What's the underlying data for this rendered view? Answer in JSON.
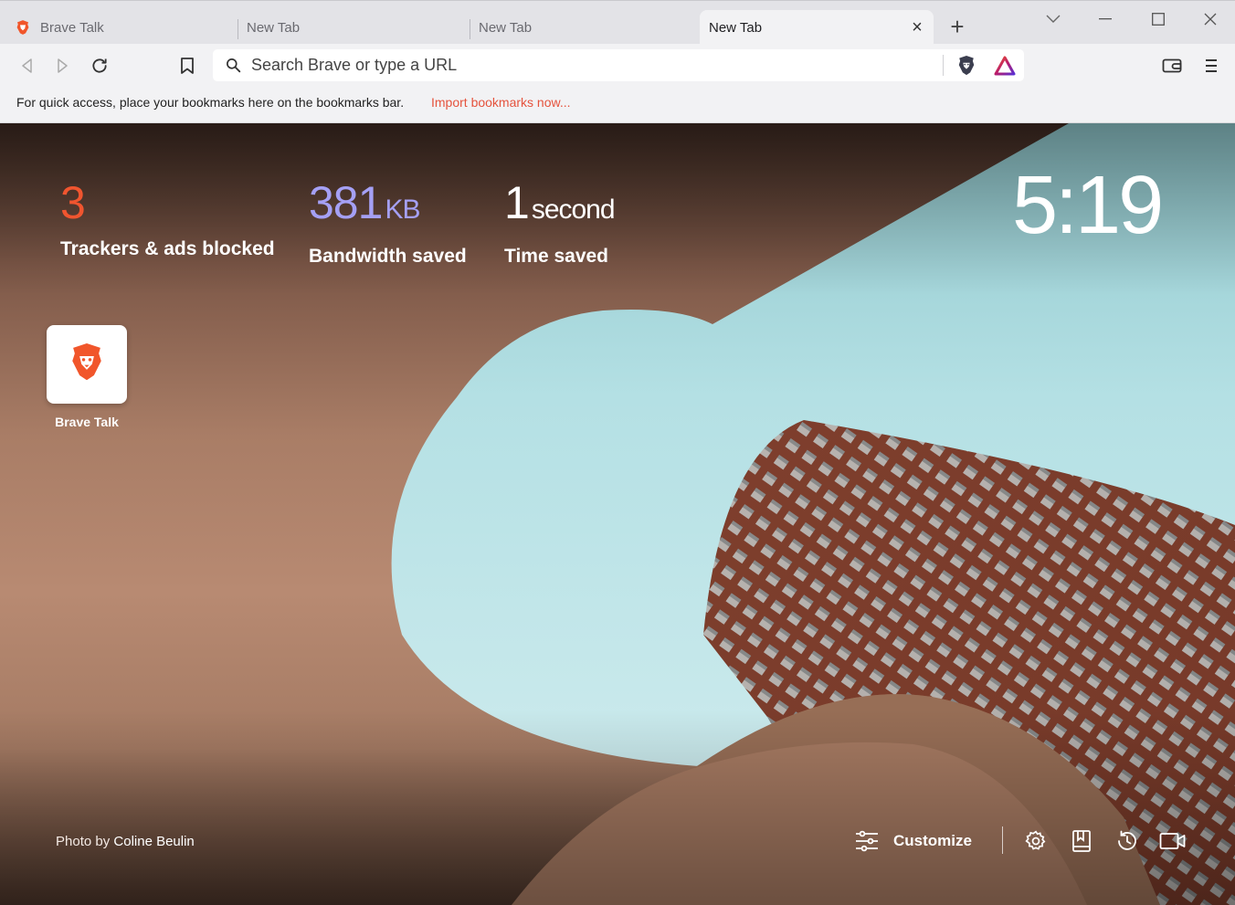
{
  "tabs": [
    {
      "title": "Brave Talk",
      "favicon": "brave-lion-icon",
      "active": false
    },
    {
      "title": "New Tab",
      "active": false
    },
    {
      "title": "New Tab",
      "active": false
    },
    {
      "title": "New Tab",
      "active": true
    }
  ],
  "window_controls": [
    "tab-search-icon",
    "minimize-icon",
    "maximize-icon",
    "close-window-icon"
  ],
  "toolbar": {
    "url_placeholder": "Search Brave or type a URL",
    "icons": [
      "back-icon",
      "forward-icon",
      "reload-icon",
      "bookmark-icon",
      "search-icon",
      "brave-shields-icon",
      "brave-rewards-icon",
      "wallet-icon",
      "menu-icon"
    ]
  },
  "bookmarks_bar": {
    "message": "For quick access, place your bookmarks here on the bookmarks bar.",
    "import_link": "Import bookmarks now..."
  },
  "stats": {
    "trackers": {
      "value": "3",
      "label": "Trackers & ads blocked",
      "color": "#f0552f"
    },
    "bandwidth": {
      "value": "381",
      "unit": "KB",
      "label": "Bandwidth saved",
      "color": "#a5a0f5"
    },
    "time": {
      "value": "1",
      "unit": "second",
      "label": "Time saved",
      "color": "#ffffff"
    }
  },
  "clock": "5:19",
  "top_sites": [
    {
      "label": "Brave Talk",
      "icon": "brave-lion-icon"
    }
  ],
  "photo_credit": {
    "prefix": "Photo by",
    "author": "Coline Beulin"
  },
  "bottom_bar": {
    "customize_label": "Customize",
    "icons": [
      "settings-icon",
      "bookmarks-icon",
      "history-icon",
      "brave-talk-camera-icon"
    ]
  },
  "colors": {
    "brand_orange": "#e5533d",
    "sky": "#b7e2e6",
    "building": "#7a3d2c"
  }
}
